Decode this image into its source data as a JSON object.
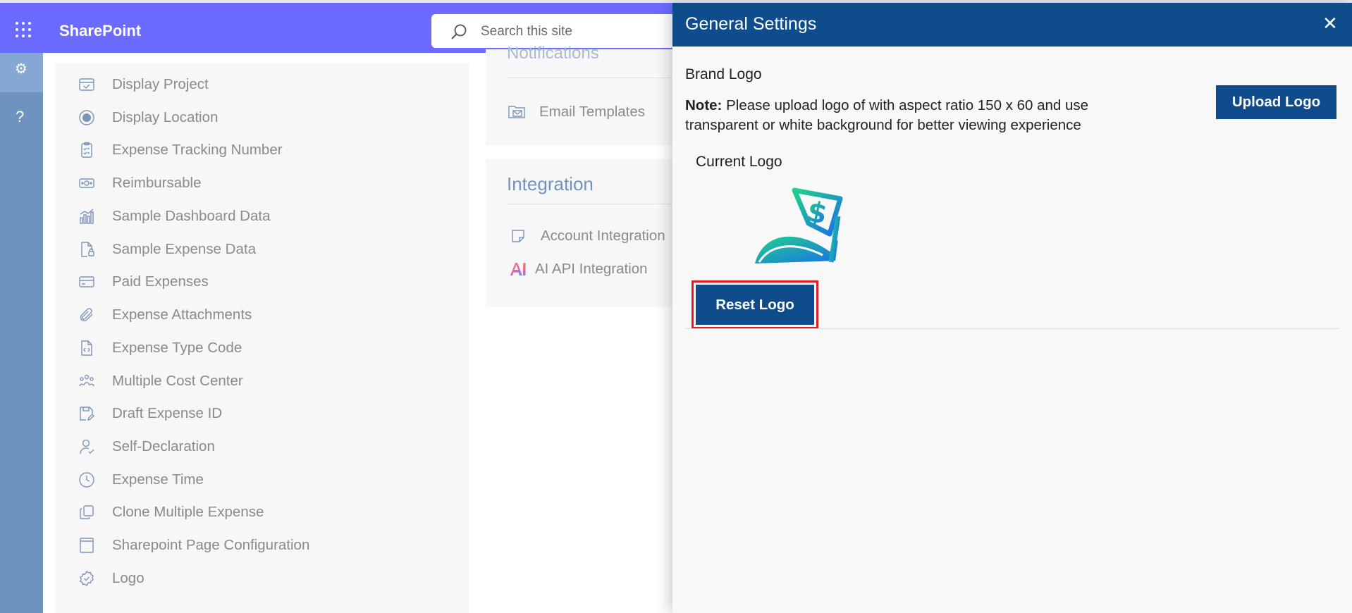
{
  "suite": {
    "brand": "SharePoint",
    "search_placeholder": "Search this site"
  },
  "rail": {
    "help_glyph": "?"
  },
  "settings_list": {
    "items": [
      {
        "label": "Display Project",
        "icon": "calendar-check-icon"
      },
      {
        "label": "Display Location",
        "icon": "radio-location-icon"
      },
      {
        "label": "Expense Tracking Number",
        "icon": "clipboard-checklist-icon"
      },
      {
        "label": "Reimbursable",
        "icon": "money-icon"
      },
      {
        "label": "Sample Dashboard Data",
        "icon": "bar-chart-icon"
      },
      {
        "label": "Sample Expense Data",
        "icon": "document-lock-icon"
      },
      {
        "label": "Paid Expenses",
        "icon": "credit-card-icon"
      },
      {
        "label": "Expense Attachments",
        "icon": "paperclip-icon"
      },
      {
        "label": "Expense Type Code",
        "icon": "code-document-icon"
      },
      {
        "label": "Multiple Cost Center",
        "icon": "people-group-icon"
      },
      {
        "label": "Draft Expense ID",
        "icon": "save-edit-icon"
      },
      {
        "label": "Self-Declaration",
        "icon": "person-check-icon"
      },
      {
        "label": "Expense Time",
        "icon": "clock-icon"
      },
      {
        "label": "Clone Multiple Expense",
        "icon": "copy-icon"
      },
      {
        "label": "Sharepoint Page Configuration",
        "icon": "page-layout-icon"
      },
      {
        "label": "Logo",
        "icon": "badge-gear-icon"
      }
    ]
  },
  "notifications_card": {
    "heading": "Notifications",
    "items": [
      {
        "label": "Email Templates",
        "icon": "email-template-icon"
      }
    ]
  },
  "integration_card": {
    "heading": "Integration",
    "items": [
      {
        "label": "Account Integration",
        "icon": "note-icon"
      },
      {
        "label": "AI API Integration",
        "icon": "ai-icon"
      }
    ]
  },
  "panel": {
    "title": "General Settings",
    "close_glyph": "✕",
    "brand_logo_label": "Brand Logo",
    "note_prefix": "Note:",
    "note_text": " Please upload logo of with aspect ratio 150 x 60 and use transparent or white background for better viewing experience",
    "upload_label": "Upload Logo",
    "current_logo_label": "Current Logo",
    "logo_symbol": "$",
    "reset_label": "Reset Logo"
  },
  "colors": {
    "suite_bar": "#6b6bff",
    "panel_header": "#0f4c8c",
    "primary_button": "#0f4c8c",
    "highlight_border": "#e02020",
    "rail": "#6f93bf"
  }
}
